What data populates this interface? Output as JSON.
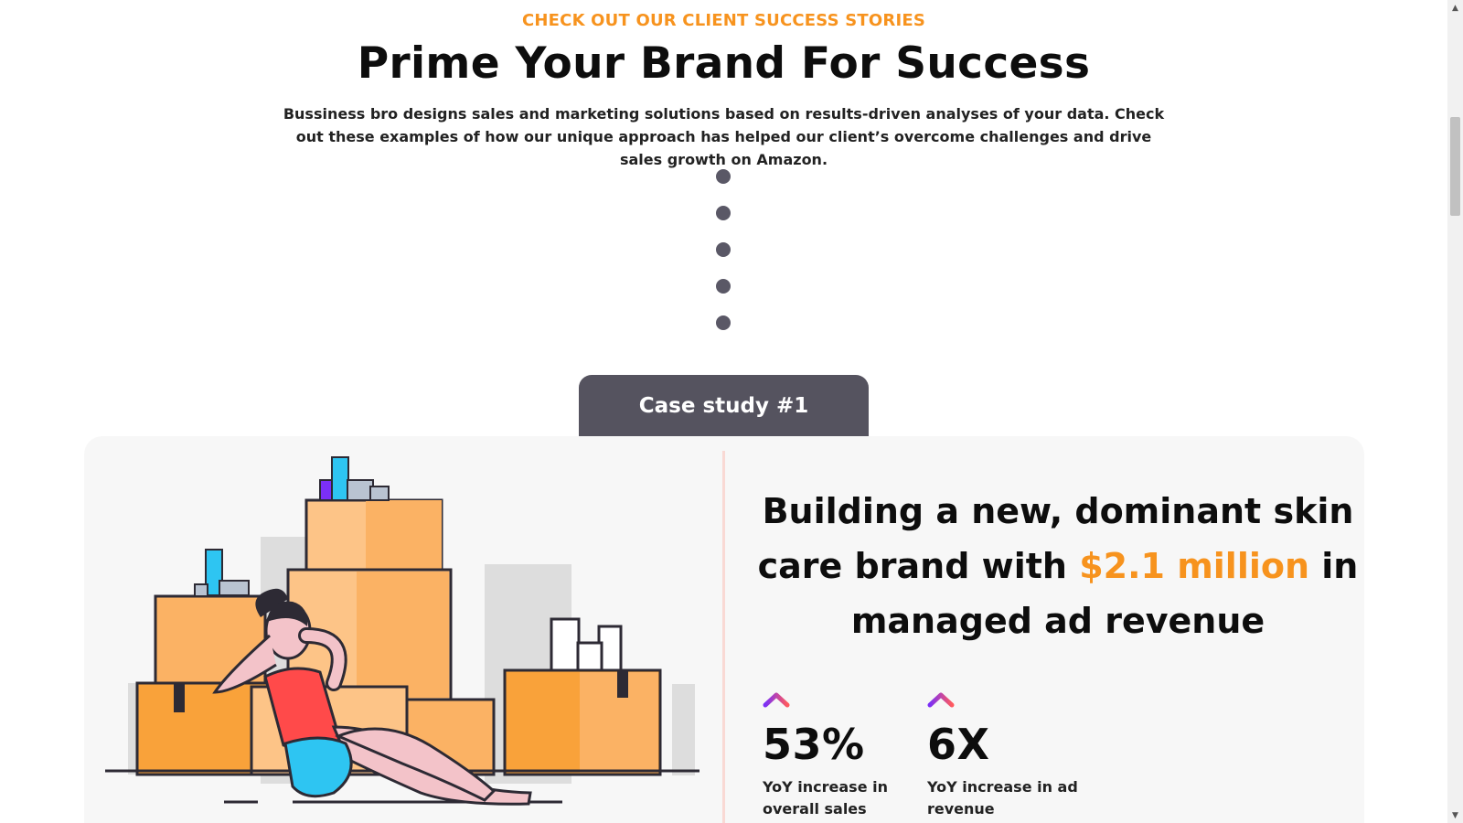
{
  "section": {
    "eyebrow": "CHECK OUT OUR CLIENT SUCCESS STORIES",
    "title": "Prime Your Brand For Success",
    "intro": "Bussiness bro designs sales and marketing solutions based on results-driven analyses of your data. Check out these examples of how our unique approach has helped our client’s overcome challenges and drive sales growth on Amazon."
  },
  "pagination": {
    "dot_count": 5,
    "dot_color": "#5a5866"
  },
  "case": {
    "tab_label": "Case study #1",
    "title_before": "Building a new, dominant skin care brand with ",
    "title_highlight": "$2.1 million",
    "title_after": " in managed ad revenue",
    "stats": [
      {
        "value": "53%",
        "description": "YoY increase in overall sales"
      },
      {
        "value": "6X",
        "description": "YoY increase in ad revenue"
      }
    ]
  },
  "colors": {
    "accent": "#f7931e",
    "tab": "#55535f",
    "card": "#f7f7f7",
    "arrow_gradient": [
      "#7b2ff7",
      "#ff5a5f"
    ]
  },
  "icons": {
    "stat_arrow": "chevron-up-icon",
    "scroll_up": "arrow-up-icon",
    "scroll_down": "arrow-down-icon"
  }
}
